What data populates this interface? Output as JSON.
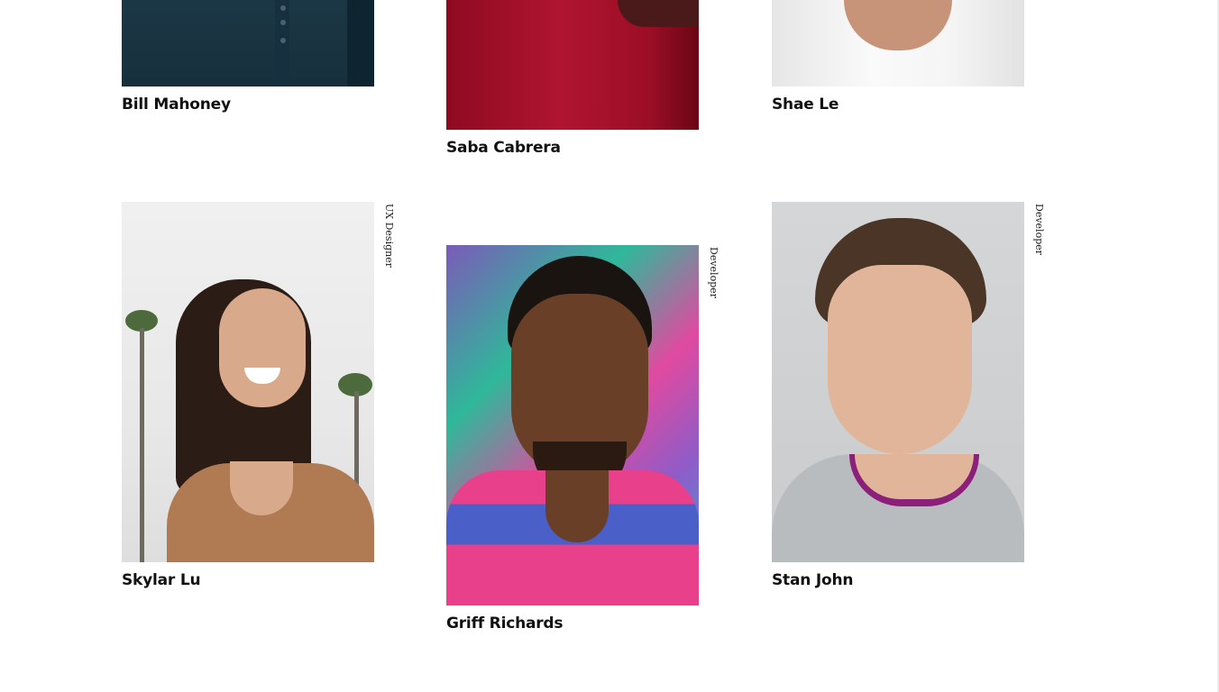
{
  "team": [
    {
      "name": "Bill Mahoney",
      "role": "",
      "image": "man-navy-polo-photo"
    },
    {
      "name": "Saba Cabrera",
      "role": "",
      "image": "person-red-sweater-photo"
    },
    {
      "name": "Shae Le",
      "role": "",
      "image": "man-white-tshirt-photo"
    },
    {
      "name": "Skylar Lu",
      "role": "UX Designer",
      "image": "smiling-woman-palm-trees-photo"
    },
    {
      "name": "Griff Richards",
      "role": "Developer",
      "image": "man-graffiti-wall-photo"
    },
    {
      "name": "Stan John",
      "role": "Developer",
      "image": "man-grey-sweatshirt-photo"
    }
  ]
}
